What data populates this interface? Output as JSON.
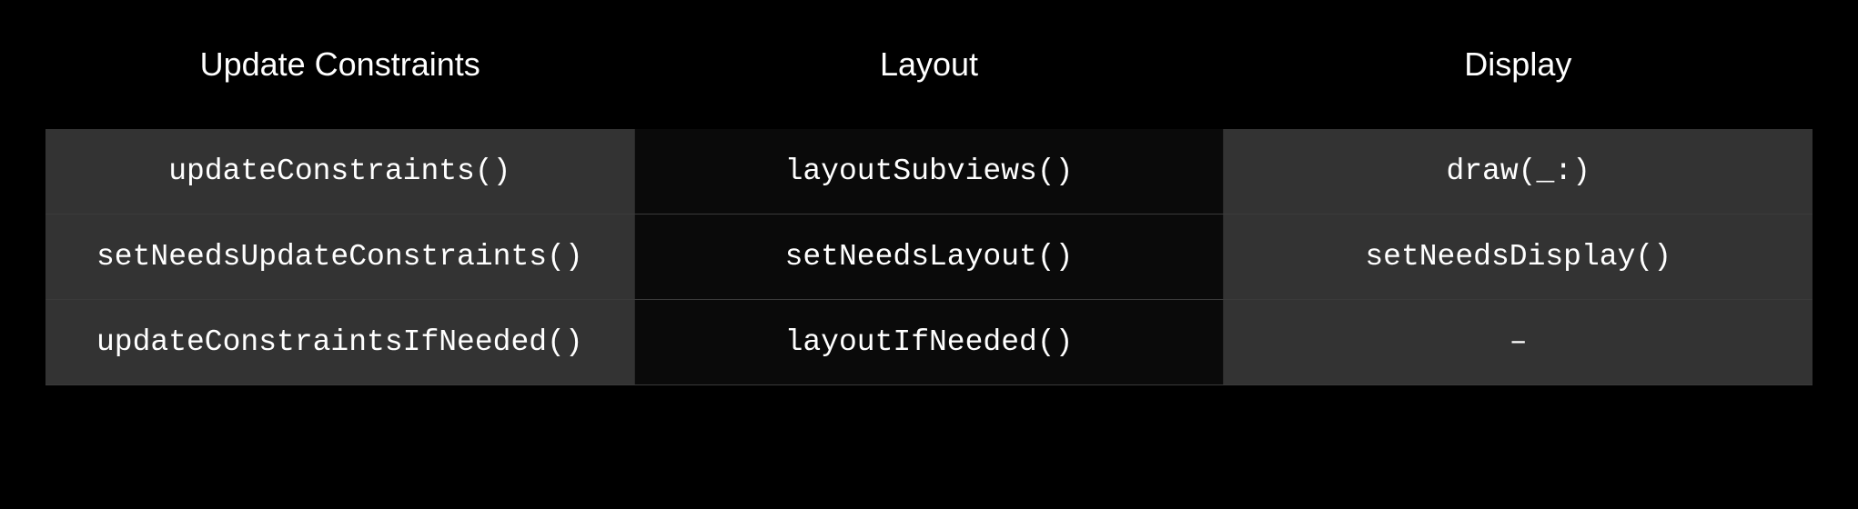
{
  "headers": {
    "col0": "Update Constraints",
    "col1": "Layout",
    "col2": "Display"
  },
  "rows": [
    {
      "col0": "updateConstraints()",
      "col1": "layoutSubviews()",
      "col2": "draw(_:)"
    },
    {
      "col0": "setNeedsUpdateConstraints()",
      "col1": "setNeedsLayout()",
      "col2": "setNeedsDisplay()"
    },
    {
      "col0": "updateConstraintsIfNeeded()",
      "col1": "layoutIfNeeded()",
      "col2": "–"
    }
  ]
}
